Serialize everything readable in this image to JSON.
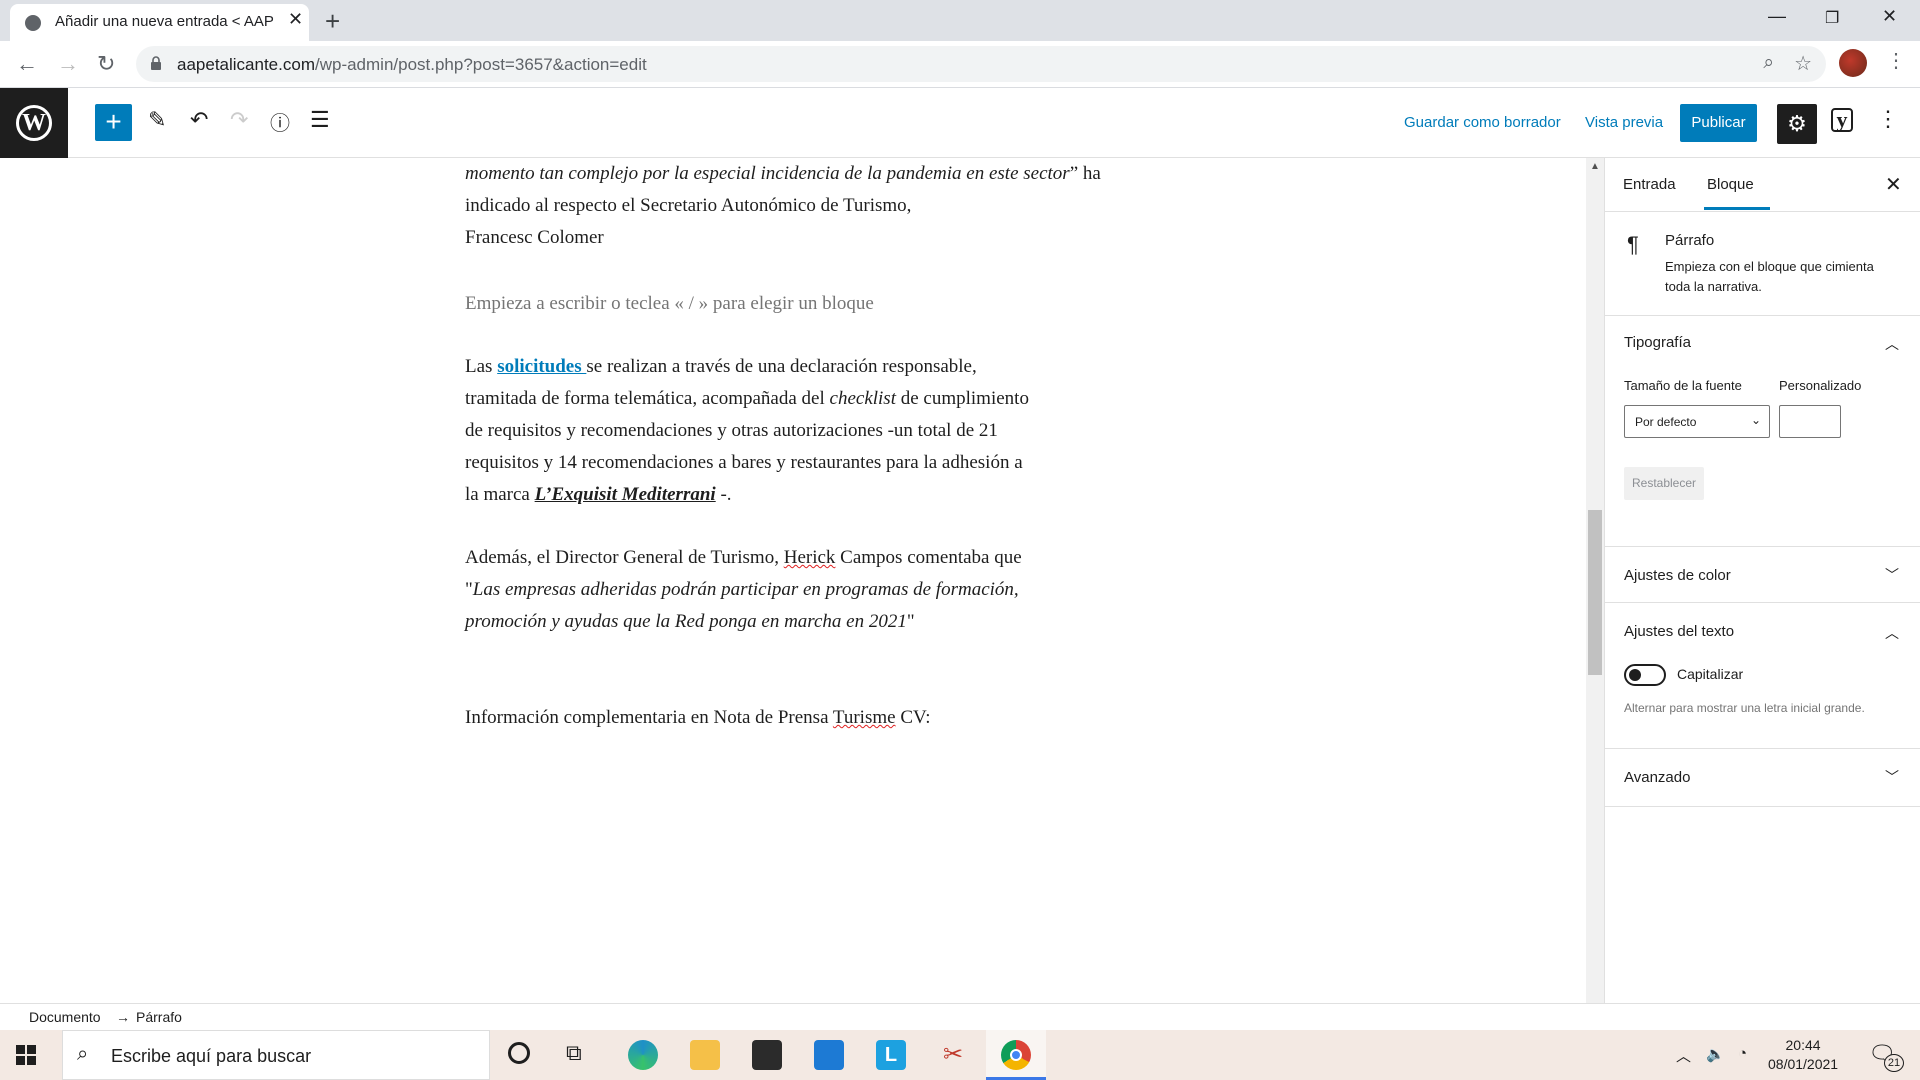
{
  "browser": {
    "tab_title": "Añadir una nueva entrada < AAP",
    "url_host": "aapetalicante.com",
    "url_path": "/wp-admin/post.php?post=3657&action=edit"
  },
  "wp_header": {
    "save_draft": "Guardar como borrador",
    "preview": "Vista previa",
    "publish": "Publicar"
  },
  "content": {
    "p1_italic": "momento tan complejo por la especial incidencia de la pandemia en este sector",
    "p1_rest": "”  ha indicado al respecto el Secretario Autonómico de Turismo,",
    "p1_line3": "Francesc Colomer",
    "placeholder": "Empieza a escribir o teclea « / » para elegir un bloque",
    "p2_pre": "Las ",
    "p2_link": "solicitudes ",
    "p2_a": "se realizan a través de una declaración responsable,",
    "p2_b": "tramitada de forma telemática, acompañada del ",
    "p2_checklist": "checklist",
    "p2_c": " de cumplimiento",
    "p2_d": "de requisitos y recomendaciones y otras autorizaciones -un total de 21",
    "p2_e": "requisitos y 14 recomendaciones a bares y restaurantes para la adhesión a",
    "p2_f": "la marca ",
    "p2_brand": "L’Exquisit Mediterrani",
    "p2_g": " -.",
    "p3_a": "Además, el Director General de Turismo, ",
    "p3_herick": "Herick",
    "p3_b": " Campos comentaba que",
    "p3_quote1": "Las empresas adheridas podrán participar en programas de formación,",
    "p3_quote2": "promoción y ayudas que la Red ponga en marcha en 2021",
    "p4_a": "Información complementaria en Nota de Prensa ",
    "p4_turisme": "Turisme",
    "p4_b": " CV:"
  },
  "sidebar": {
    "tab_entrada": "Entrada",
    "tab_bloque": "Bloque",
    "block_name": "Párrafo",
    "block_desc_1": "Empieza con el bloque que cimienta",
    "block_desc_2": "toda la narrativa.",
    "typography": "Tipografía",
    "font_size_label": "Tamaño de la fuente",
    "custom_label": "Personalizado",
    "font_size_value": "Por defecto",
    "reset": "Restablecer",
    "color_settings": "Ajustes de color",
    "text_settings": "Ajustes del texto",
    "drop_cap": "Capitalizar",
    "drop_cap_help": "Alternar para mostrar una letra inicial grande.",
    "advanced": "Avanzado"
  },
  "footer": {
    "crumb_doc": "Documento",
    "crumb_arrow": "→",
    "crumb_block": "Párrafo"
  },
  "taskbar": {
    "search_placeholder": "Escribe aquí para buscar",
    "time": "20:44",
    "date": "08/01/2021",
    "notifications": "21"
  }
}
